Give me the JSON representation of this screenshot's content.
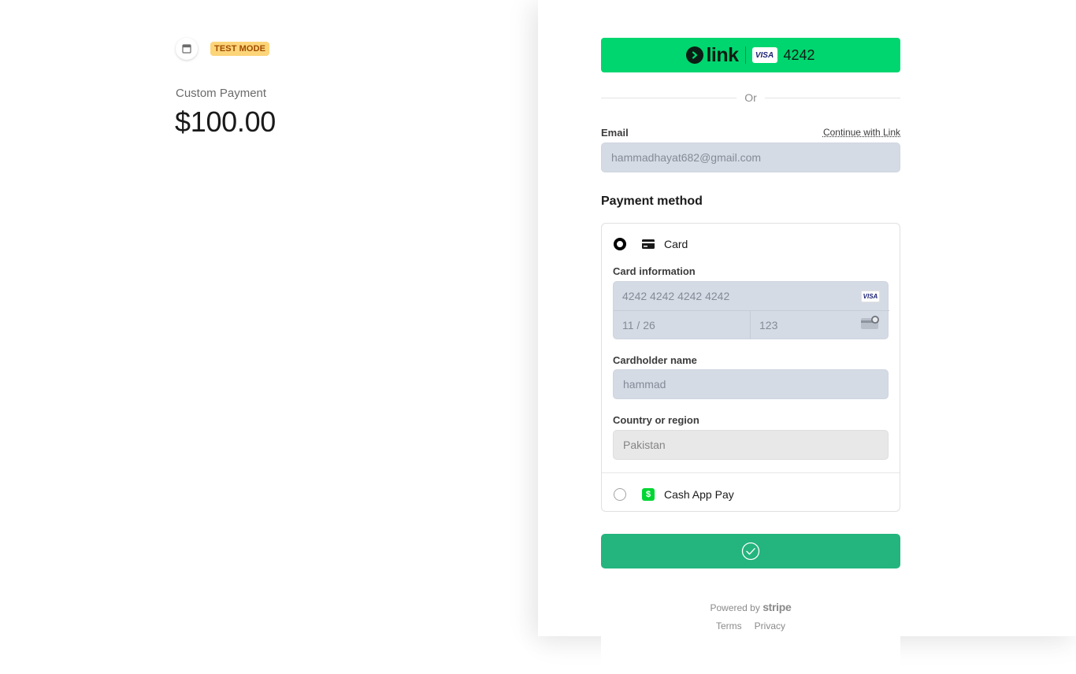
{
  "merchant": {
    "store_icon": "store-icon",
    "test_badge": "TEST MODE",
    "product_name": "Custom Payment",
    "amount": "$100.00"
  },
  "link_button": {
    "logo_text": "link",
    "card_brand": "VISA",
    "last4": "4242",
    "color": "#00d66f"
  },
  "divider": {
    "text": "Or"
  },
  "email": {
    "label": "Email",
    "continue_link": "Continue with Link",
    "value": "hammadhayat682@gmail.com"
  },
  "payment_method": {
    "title": "Payment method",
    "card": {
      "label": "Card",
      "selected": true,
      "icon": "credit-card-icon",
      "card_info_label": "Card information",
      "number": "4242 4242 4242 4242",
      "brand": "VISA",
      "expiry": "11 / 26",
      "cvc": "123",
      "cardholder_label": "Cardholder name",
      "cardholder": "hammad",
      "country_label": "Country or region",
      "country": "Pakistan"
    },
    "cash_app": {
      "label": "Cash App Pay",
      "selected": false,
      "icon": "cash-app-icon",
      "icon_glyph": "$"
    }
  },
  "pay_button": {
    "state": "success",
    "icon": "check-circle-icon",
    "color": "#24b47e"
  },
  "footer": {
    "powered_by": "Powered by",
    "brand": "stripe",
    "links": [
      "Terms",
      "Privacy"
    ]
  }
}
